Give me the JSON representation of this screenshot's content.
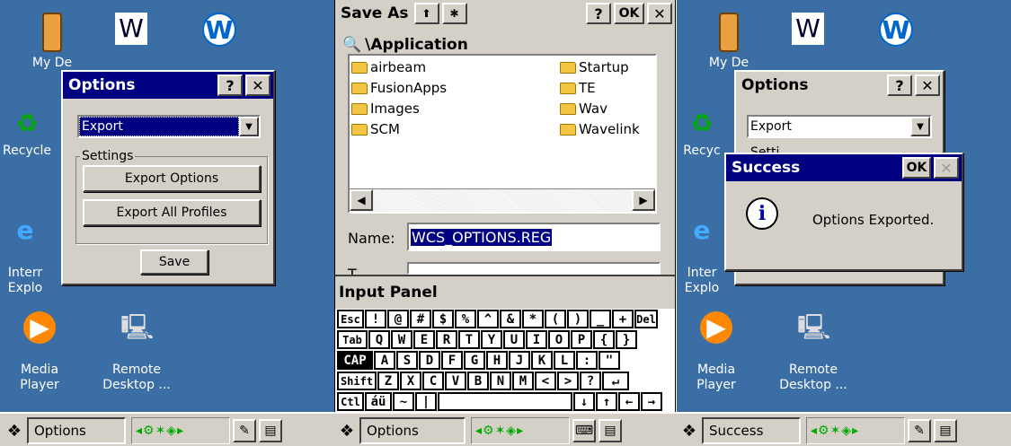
{
  "panel1": {
    "desktop_icons": [
      {
        "name": "my-device",
        "label": "My De"
      },
      {
        "name": "word",
        "label": ""
      },
      {
        "name": "wavelink",
        "label": ""
      },
      {
        "name": "recycle-bin",
        "label": "Recycle"
      },
      {
        "name": "internet-explorer",
        "label": "Interr\nExplo"
      },
      {
        "name": "media-player",
        "label": "Media\nPlayer"
      },
      {
        "name": "remote-desktop",
        "label": "Remote\nDesktop ..."
      }
    ],
    "options": {
      "title": "Options",
      "help": "?",
      "close": "✕",
      "combo_value": "Export",
      "group_label": "Settings",
      "export_options": "Export Options",
      "export_all": "Export All Profiles",
      "save": "Save"
    },
    "taskbar": {
      "active": "Options"
    }
  },
  "panel2": {
    "saveas": {
      "title": "Save As",
      "help": "?",
      "ok": "OK",
      "close": "✕"
    },
    "path": "\\Application",
    "folders_left": [
      "airbeam",
      "FusionApps",
      "Images",
      "SCM"
    ],
    "folders_right": [
      "Startup",
      "TE",
      "Wav",
      "Wavelink"
    ],
    "name_label": "Name:",
    "name_value": "WCS_OPTIONS.REG",
    "type_label": "T",
    "input_panel": "Input Panel",
    "keyboard": [
      [
        "Esc",
        "!",
        "@",
        "#",
        "$",
        "%",
        "^",
        "&",
        "*",
        "(",
        ")",
        "_",
        "+",
        "Del"
      ],
      [
        "Tab",
        "Q",
        "W",
        "E",
        "R",
        "T",
        "Y",
        "U",
        "I",
        "O",
        "P",
        "{",
        "}"
      ],
      [
        "CAP",
        "A",
        "S",
        "D",
        "F",
        "G",
        "H",
        "J",
        "K",
        "L",
        ":",
        "\""
      ],
      [
        "Shift",
        "Z",
        "X",
        "C",
        "V",
        "B",
        "N",
        "M",
        "<",
        ">",
        "?",
        "↵"
      ],
      [
        "Ctl",
        "áü",
        "~",
        "|",
        "",
        "↓",
        "↑",
        "←",
        "→"
      ]
    ],
    "taskbar": {
      "active": "Options"
    }
  },
  "panel3": {
    "options": {
      "title": "Options",
      "help": "?",
      "close": "✕",
      "combo_value": "Export",
      "group_label": "Setti"
    },
    "success": {
      "title": "Success",
      "ok": "OK",
      "close": "✕",
      "message": "Options Exported."
    },
    "desktop_labels": {
      "my_device": "My De",
      "recycle": "Recyc",
      "ie": "Inter\nExplo",
      "media": "Media\nPlayer",
      "remote": "Remote\nDesktop ..."
    },
    "taskbar": {
      "active": "Success"
    }
  },
  "colors": {
    "desktop": "#3a6ea5",
    "title_bar": "#000080",
    "face": "#d4d0c8",
    "selection": "#000080"
  }
}
